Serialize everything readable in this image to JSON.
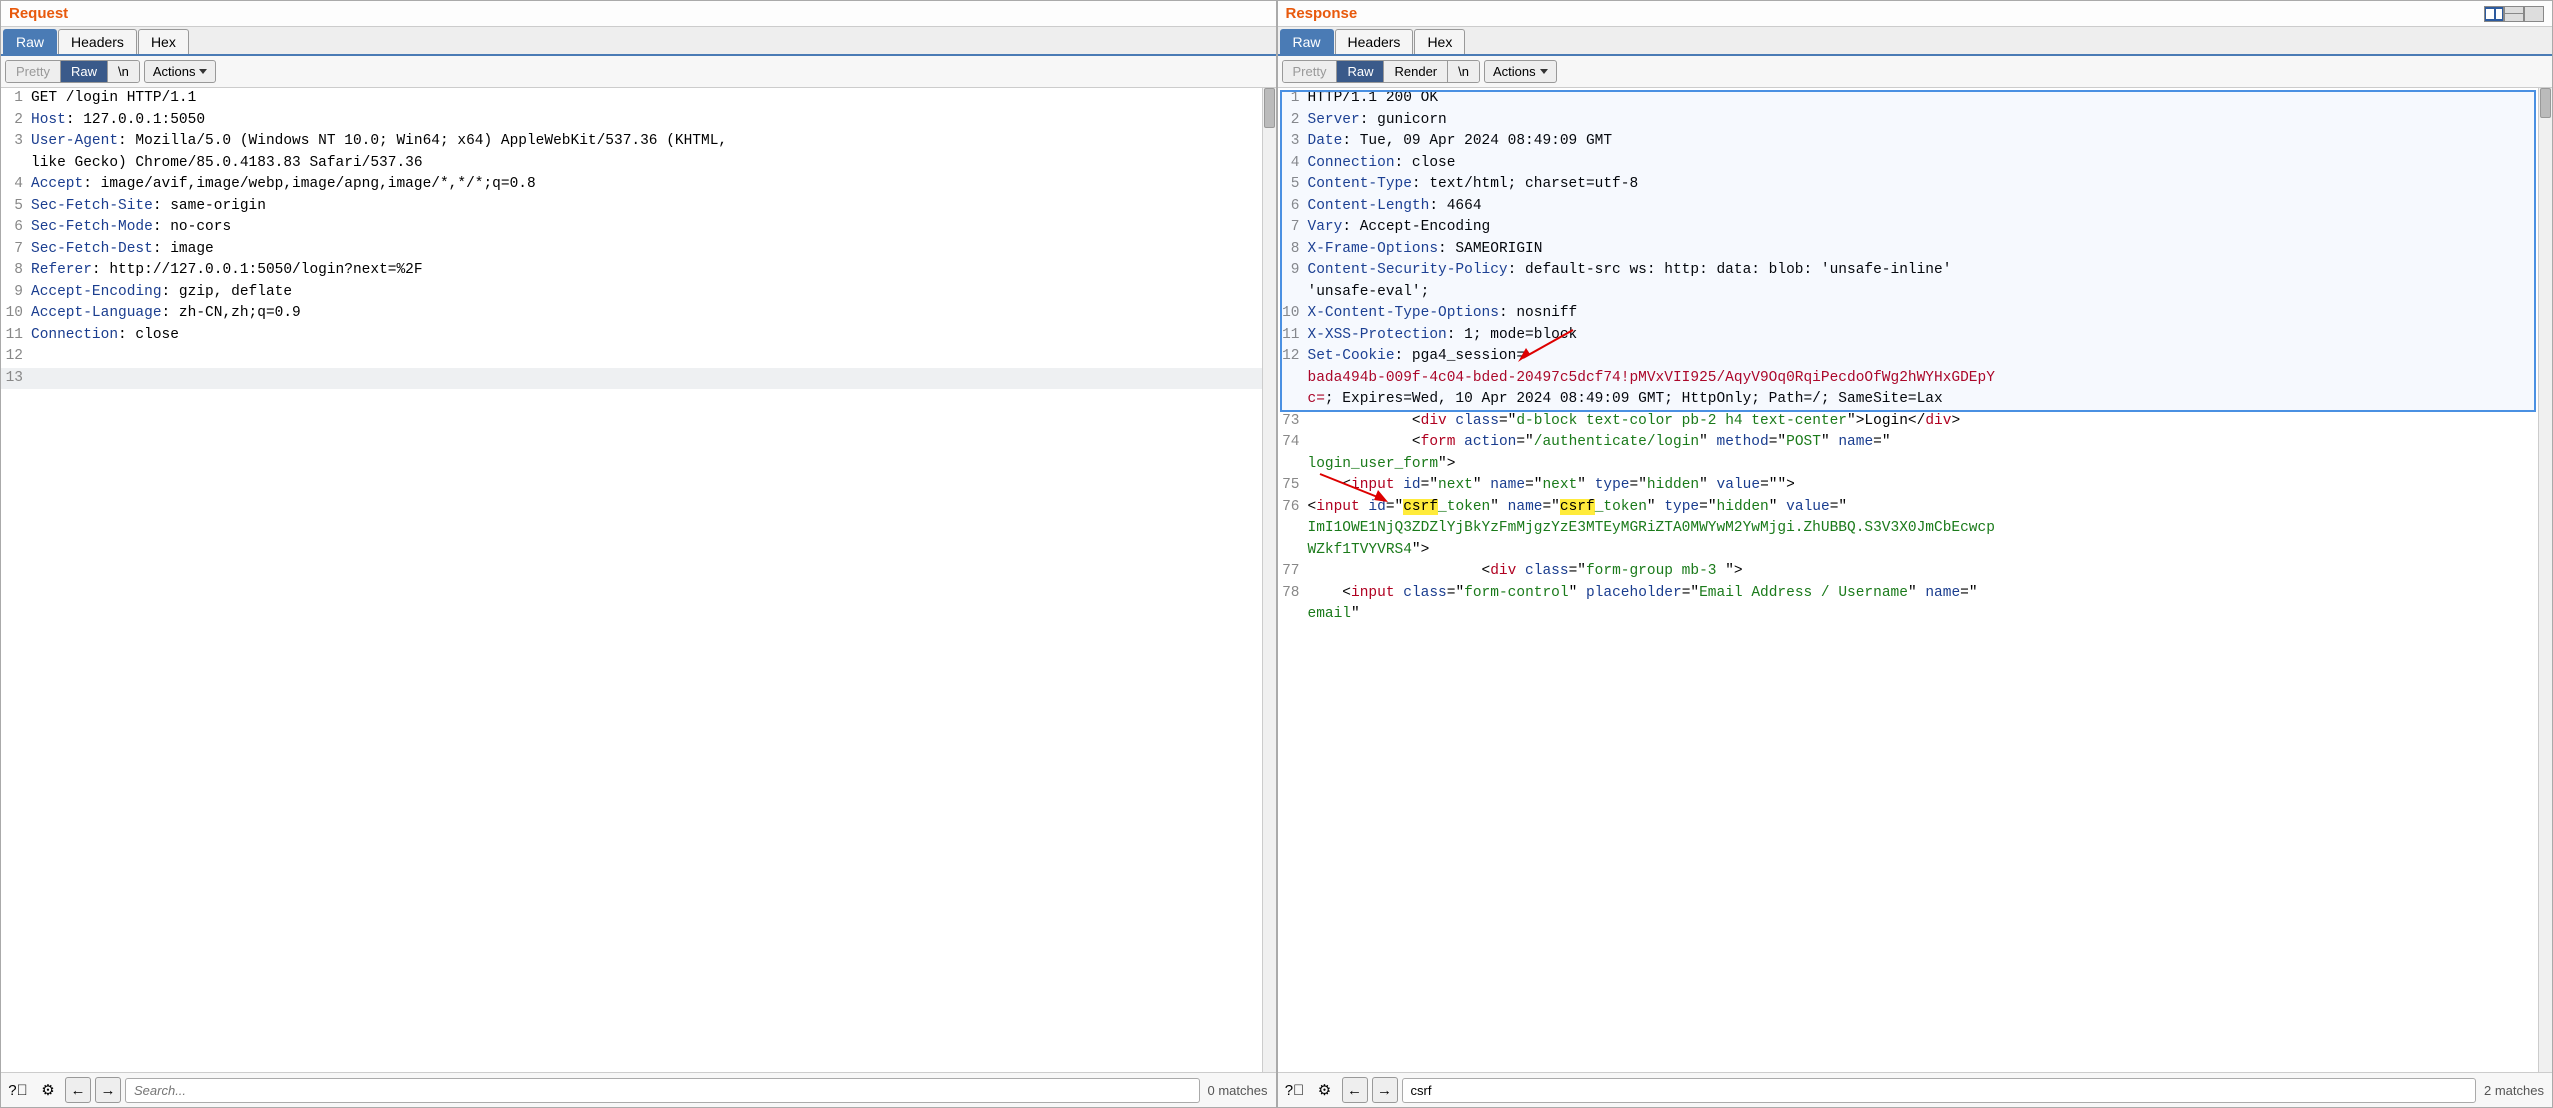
{
  "request": {
    "title": "Request",
    "mainTabs": [
      "Raw",
      "Headers",
      "Hex"
    ],
    "activeMainTab": 0,
    "subTabs": [
      "Pretty",
      "Raw",
      "\\n"
    ],
    "activeSubTab": 1,
    "actions_label": "Actions",
    "lines": [
      {
        "n": "1",
        "segs": [
          {
            "t": "GET /login HTTP/1.1",
            "c": ""
          }
        ]
      },
      {
        "n": "2",
        "segs": [
          {
            "t": "Host",
            "c": "hl-key"
          },
          {
            "t": ": 127.0.0.1:5050",
            "c": ""
          }
        ]
      },
      {
        "n": "3",
        "segs": [
          {
            "t": "User-Agent",
            "c": "hl-key"
          },
          {
            "t": ": Mozilla/5.0 (Windows NT 10.0; Win64; x64) AppleWebKit/537.36 (KHTML, ",
            "c": ""
          }
        ]
      },
      {
        "n": "",
        "segs": [
          {
            "t": "like Gecko) Chrome/85.0.4183.83 Safari/537.36",
            "c": ""
          }
        ]
      },
      {
        "n": "4",
        "segs": [
          {
            "t": "Accept",
            "c": "hl-key"
          },
          {
            "t": ": image/avif,image/webp,image/apng,image/*,*/*;q=0.8",
            "c": ""
          }
        ]
      },
      {
        "n": "5",
        "segs": [
          {
            "t": "Sec-Fetch-Site",
            "c": "hl-key"
          },
          {
            "t": ": same-origin",
            "c": ""
          }
        ]
      },
      {
        "n": "6",
        "segs": [
          {
            "t": "Sec-Fetch-Mode",
            "c": "hl-key"
          },
          {
            "t": ": no-cors",
            "c": ""
          }
        ]
      },
      {
        "n": "7",
        "segs": [
          {
            "t": "Sec-Fetch-Dest",
            "c": "hl-key"
          },
          {
            "t": ": image",
            "c": ""
          }
        ]
      },
      {
        "n": "8",
        "segs": [
          {
            "t": "Referer",
            "c": "hl-key"
          },
          {
            "t": ": http://127.0.0.1:5050/login?next=%2F",
            "c": ""
          }
        ]
      },
      {
        "n": "9",
        "segs": [
          {
            "t": "Accept-Encoding",
            "c": "hl-key"
          },
          {
            "t": ": gzip, deflate",
            "c": ""
          }
        ]
      },
      {
        "n": "10",
        "segs": [
          {
            "t": "Accept-Language",
            "c": "hl-key"
          },
          {
            "t": ": zh-CN,zh;q=0.9",
            "c": ""
          }
        ]
      },
      {
        "n": "11",
        "segs": [
          {
            "t": "Connection",
            "c": "hl-key"
          },
          {
            "t": ": close",
            "c": ""
          }
        ]
      },
      {
        "n": "12",
        "segs": [
          {
            "t": "",
            "c": ""
          }
        ]
      },
      {
        "n": "13",
        "segs": [
          {
            "t": "",
            "c": ""
          }
        ],
        "current": true
      }
    ],
    "search_placeholder": "Search...",
    "match_text": "0 matches"
  },
  "response": {
    "title": "Response",
    "mainTabs": [
      "Raw",
      "Headers",
      "Hex"
    ],
    "activeMainTab": 0,
    "subTabs": [
      "Pretty",
      "Raw",
      "Render",
      "\\n"
    ],
    "activeSubTab": 1,
    "actions_label": "Actions",
    "lines": [
      {
        "n": "1",
        "segs": [
          {
            "t": "HTTP/1.1 200 OK",
            "c": ""
          }
        ]
      },
      {
        "n": "2",
        "segs": [
          {
            "t": "Server",
            "c": "hl-key"
          },
          {
            "t": ": gunicorn",
            "c": ""
          }
        ]
      },
      {
        "n": "3",
        "segs": [
          {
            "t": "Date",
            "c": "hl-key"
          },
          {
            "t": ": Tue, 09 Apr 2024 08:49:09 GMT",
            "c": ""
          }
        ]
      },
      {
        "n": "4",
        "segs": [
          {
            "t": "Connection",
            "c": "hl-key"
          },
          {
            "t": ": close",
            "c": ""
          }
        ]
      },
      {
        "n": "5",
        "segs": [
          {
            "t": "Content-Type",
            "c": "hl-key"
          },
          {
            "t": ": text/html; charset=utf-8",
            "c": ""
          }
        ]
      },
      {
        "n": "6",
        "segs": [
          {
            "t": "Content-Length",
            "c": "hl-key"
          },
          {
            "t": ": 4664",
            "c": ""
          }
        ]
      },
      {
        "n": "7",
        "segs": [
          {
            "t": "Vary",
            "c": "hl-key"
          },
          {
            "t": ": Accept-Encoding",
            "c": ""
          }
        ]
      },
      {
        "n": "8",
        "segs": [
          {
            "t": "X-Frame-Options",
            "c": "hl-key"
          },
          {
            "t": ": SAMEORIGIN",
            "c": ""
          }
        ]
      },
      {
        "n": "9",
        "segs": [
          {
            "t": "Content-Security-Policy",
            "c": "hl-key"
          },
          {
            "t": ": default-src ws: http: data: blob: 'unsafe-inline' ",
            "c": ""
          }
        ]
      },
      {
        "n": "",
        "segs": [
          {
            "t": "'unsafe-eval';",
            "c": ""
          }
        ]
      },
      {
        "n": "10",
        "segs": [
          {
            "t": "X-Content-Type-Options",
            "c": "hl-key"
          },
          {
            "t": ": nosniff",
            "c": ""
          }
        ]
      },
      {
        "n": "11",
        "segs": [
          {
            "t": "X-XSS-Protection",
            "c": "hl-key"
          },
          {
            "t": ": 1; mode=block",
            "c": ""
          }
        ]
      },
      {
        "n": "12",
        "segs": [
          {
            "t": "Set-Cookie",
            "c": "hl-key"
          },
          {
            "t": ": pga4_session=",
            "c": ""
          }
        ]
      },
      {
        "n": "",
        "segs": [
          {
            "t": "bada494b-009f-4c04-bded-20497c5dcf74!pMVxVII925/AqyV9Oq0RqiPecdoOfWg2hWYHxGDEpY",
            "c": "hl-red"
          }
        ]
      },
      {
        "n": "",
        "segs": [
          {
            "t": "c=",
            "c": "hl-red"
          },
          {
            "t": "; Expires=Wed, 10 Apr 2024 08:49:09 GMT; HttpOnly; Path=/; SameSite=Lax",
            "c": ""
          }
        ]
      },
      {
        "n": "73",
        "segs": [
          {
            "t": "            <",
            "c": ""
          },
          {
            "t": "div",
            "c": "hl-tag"
          },
          {
            "t": " class",
            "c": "hl-key"
          },
          {
            "t": "=\"",
            "c": ""
          },
          {
            "t": "d-block text-color pb-2 h4 text-center",
            "c": "hl-green"
          },
          {
            "t": "\">Login</",
            "c": ""
          },
          {
            "t": "div",
            "c": "hl-tag"
          },
          {
            "t": ">",
            "c": ""
          }
        ]
      },
      {
        "n": "74",
        "segs": [
          {
            "t": "            <",
            "c": ""
          },
          {
            "t": "form",
            "c": "hl-tag"
          },
          {
            "t": " action",
            "c": "hl-key"
          },
          {
            "t": "=\"",
            "c": ""
          },
          {
            "t": "/authenticate/login",
            "c": "hl-green"
          },
          {
            "t": "\" ",
            "c": ""
          },
          {
            "t": "method",
            "c": "hl-key"
          },
          {
            "t": "=\"",
            "c": ""
          },
          {
            "t": "POST",
            "c": "hl-green"
          },
          {
            "t": "\" ",
            "c": ""
          },
          {
            "t": "name",
            "c": "hl-key"
          },
          {
            "t": "=\"",
            "c": ""
          }
        ]
      },
      {
        "n": "",
        "segs": [
          {
            "t": "login_user_form",
            "c": "hl-green"
          },
          {
            "t": "\">",
            "c": ""
          }
        ]
      },
      {
        "n": "75",
        "segs": [
          {
            "t": "    <",
            "c": ""
          },
          {
            "t": "input",
            "c": "hl-tag"
          },
          {
            "t": " id",
            "c": "hl-key"
          },
          {
            "t": "=\"",
            "c": ""
          },
          {
            "t": "next",
            "c": "hl-green"
          },
          {
            "t": "\" ",
            "c": ""
          },
          {
            "t": "name",
            "c": "hl-key"
          },
          {
            "t": "=\"",
            "c": ""
          },
          {
            "t": "next",
            "c": "hl-green"
          },
          {
            "t": "\" ",
            "c": ""
          },
          {
            "t": "type",
            "c": "hl-key"
          },
          {
            "t": "=\"",
            "c": ""
          },
          {
            "t": "hidden",
            "c": "hl-green"
          },
          {
            "t": "\" ",
            "c": ""
          },
          {
            "t": "value",
            "c": "hl-key"
          },
          {
            "t": "=\"\">",
            "c": ""
          }
        ]
      },
      {
        "n": "76",
        "segs": [
          {
            "t": "<",
            "c": ""
          },
          {
            "t": "input",
            "c": "hl-tag"
          },
          {
            "t": " id",
            "c": "hl-key"
          },
          {
            "t": "=\"",
            "c": ""
          },
          {
            "t": "csrf",
            "c": "hl-mark"
          },
          {
            "t": "_token",
            "c": "hl-green"
          },
          {
            "t": "\" ",
            "c": ""
          },
          {
            "t": "name",
            "c": "hl-key"
          },
          {
            "t": "=\"",
            "c": ""
          },
          {
            "t": "csrf",
            "c": "hl-mark"
          },
          {
            "t": "_token",
            "c": "hl-green"
          },
          {
            "t": "\" ",
            "c": ""
          },
          {
            "t": "type",
            "c": "hl-key"
          },
          {
            "t": "=\"",
            "c": ""
          },
          {
            "t": "hidden",
            "c": "hl-green"
          },
          {
            "t": "\" ",
            "c": ""
          },
          {
            "t": "value",
            "c": "hl-key"
          },
          {
            "t": "=\"",
            "c": ""
          }
        ]
      },
      {
        "n": "",
        "segs": [
          {
            "t": "ImI1OWE1NjQ3ZDZlYjBkYzFmMjgzYzE3MTEyMGRiZTA0MWYwM2YwMjgi.ZhUBBQ.S3V3X0JmCbEcwcp",
            "c": "hl-green"
          }
        ]
      },
      {
        "n": "",
        "segs": [
          {
            "t": "WZkf1TVYVRS4",
            "c": "hl-green"
          },
          {
            "t": "\">",
            "c": ""
          }
        ]
      },
      {
        "n": "77",
        "segs": [
          {
            "t": "                    <",
            "c": ""
          },
          {
            "t": "div",
            "c": "hl-tag"
          },
          {
            "t": " class",
            "c": "hl-key"
          },
          {
            "t": "=\"",
            "c": ""
          },
          {
            "t": "form-group mb-3 ",
            "c": "hl-green"
          },
          {
            "t": "\">",
            "c": ""
          }
        ]
      },
      {
        "n": "78",
        "segs": [
          {
            "t": "    <",
            "c": ""
          },
          {
            "t": "input",
            "c": "hl-tag"
          },
          {
            "t": " class",
            "c": "hl-key"
          },
          {
            "t": "=\"",
            "c": ""
          },
          {
            "t": "form-control",
            "c": "hl-green"
          },
          {
            "t": "\" ",
            "c": ""
          },
          {
            "t": "placeholder",
            "c": "hl-key"
          },
          {
            "t": "=\"",
            "c": ""
          },
          {
            "t": "Email Address / Username",
            "c": "hl-green"
          },
          {
            "t": "\" ",
            "c": ""
          },
          {
            "t": "name",
            "c": "hl-key"
          },
          {
            "t": "=\"",
            "c": ""
          }
        ]
      },
      {
        "n": "",
        "segs": [
          {
            "t": "email",
            "c": "hl-green"
          },
          {
            "t": "\"",
            "c": ""
          }
        ]
      }
    ],
    "search_value": "csrf",
    "search_placeholder": "Search...",
    "match_text": "2 matches"
  }
}
